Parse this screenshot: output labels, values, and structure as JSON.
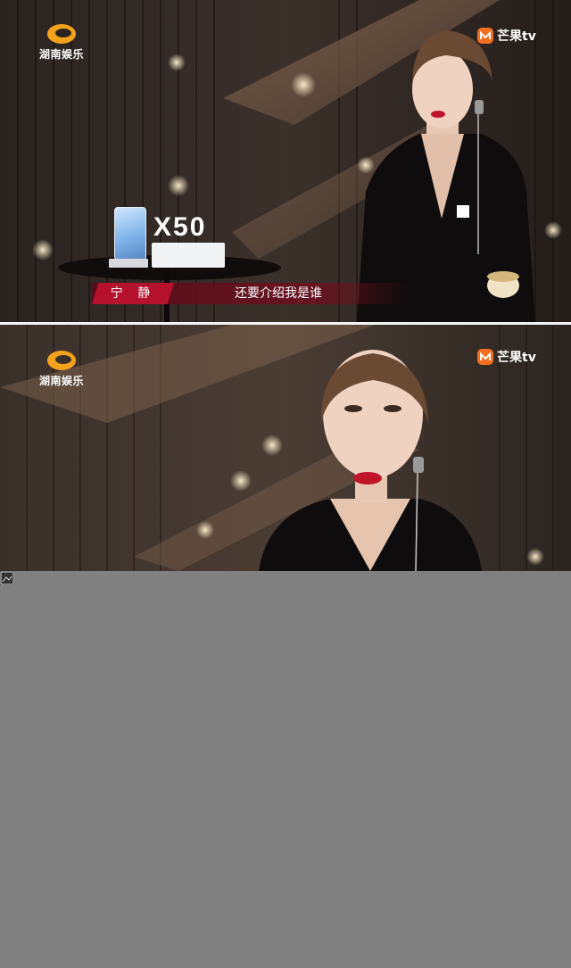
{
  "frames": [
    {
      "logo_left_text": "湖南娱乐",
      "logo_right_text": "芒果tv",
      "product_text": "X50",
      "caption": {
        "name": "宁 静",
        "line": "还要介绍我是谁"
      }
    },
    {
      "logo_left_text": "湖南娱乐",
      "logo_right_text": "芒果tv"
    }
  ],
  "colors": {
    "background": "#808080",
    "caption_accent": "#b5102c",
    "lips": "#c0142a"
  },
  "icons": [
    "broken-image-icon"
  ]
}
